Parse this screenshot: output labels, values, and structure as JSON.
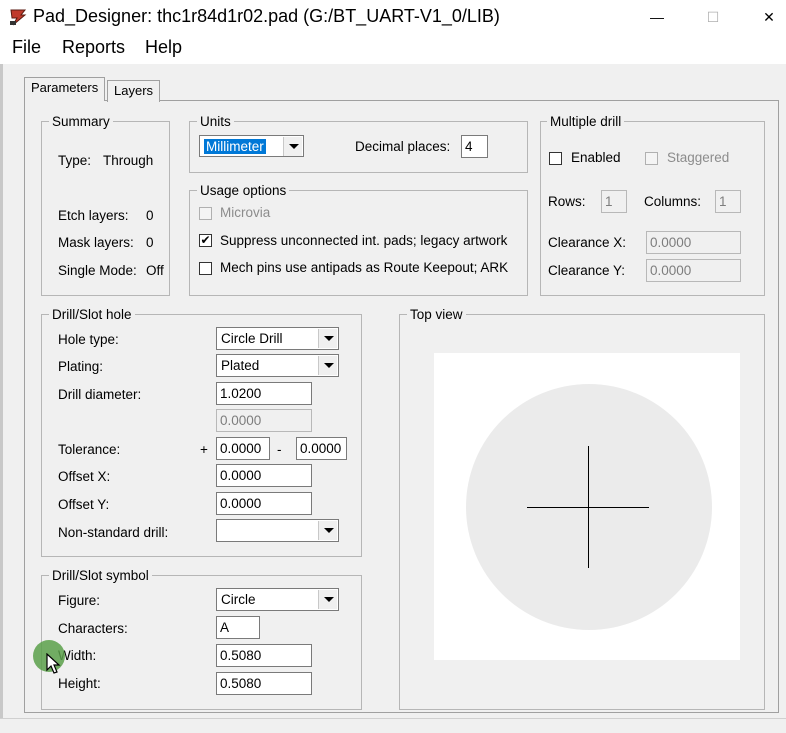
{
  "window": {
    "title": "Pad_Designer: thc1r84d1r02.pad (G:/BT_UART-V1_0/LIB)",
    "minimize_glyph": "—",
    "maximize_glyph": "☐",
    "close_glyph": "✕"
  },
  "menu": {
    "file": "File",
    "reports": "Reports",
    "help": "Help"
  },
  "tabs": {
    "parameters": "Parameters",
    "layers": "Layers"
  },
  "summary": {
    "title": "Summary",
    "type_label": "Type:",
    "type_value": "Through",
    "etch_label": "Etch layers:",
    "etch_value": "0",
    "mask_label": "Mask layers:",
    "mask_value": "0",
    "single_label": "Single Mode:",
    "single_value": "Off"
  },
  "units": {
    "title": "Units",
    "unit_value": "Millimeter",
    "decimal_label": "Decimal places:",
    "decimal_value": "4"
  },
  "usage": {
    "title": "Usage options",
    "microvia": {
      "label": "Microvia",
      "checked": false,
      "enabled": false
    },
    "suppress": {
      "label": "Suppress unconnected int. pads; legacy artwork",
      "checked": true,
      "mark": "✔"
    },
    "mech": {
      "label": "Mech pins use antipads as Route Keepout; ARK",
      "checked": false
    }
  },
  "multiple_drill": {
    "title": "Multiple drill",
    "enabled_label": "Enabled",
    "staggered_label": "Staggered",
    "rows_label": "Rows:",
    "rows_value": "1",
    "columns_label": "Columns:",
    "columns_value": "1",
    "clearance_x_label": "Clearance X:",
    "clearance_x_value": "0.0000",
    "clearance_y_label": "Clearance Y:",
    "clearance_y_value": "0.0000"
  },
  "drill_slot_hole": {
    "title": "Drill/Slot hole",
    "hole_type_label": "Hole type:",
    "hole_type_value": "Circle Drill",
    "plating_label": "Plating:",
    "plating_value": "Plated",
    "drill_diameter_label": "Drill diameter:",
    "drill_diameter_value": "1.0200",
    "secondary_value": "0.0000",
    "tolerance_label": "Tolerance:",
    "plus": "+",
    "minus": "-",
    "tolerance_plus_value": "0.0000",
    "tolerance_minus_value": "0.0000",
    "offset_x_label": "Offset X:",
    "offset_x_value": "0.0000",
    "offset_y_label": "Offset Y:",
    "offset_y_value": "0.0000",
    "non_standard_label": "Non-standard drill:",
    "non_standard_value": ""
  },
  "drill_slot_symbol": {
    "title": "Drill/Slot symbol",
    "figure_label": "Figure:",
    "figure_value": "Circle",
    "characters_label": "Characters:",
    "characters_value": "A",
    "width_label": "Width:",
    "width_value": "0.5080",
    "height_label": "Height:",
    "height_value": "0.5080"
  },
  "top_view": {
    "title": "Top view"
  },
  "colors": {
    "selection": "#0078d7",
    "pad_fill": "#ebebeb",
    "dialog_bg": "#f0f0f0",
    "app_icon": "#c0392b"
  },
  "icons": {
    "app": "pad-designer-icon",
    "cursor": "mouse-cursor-icon"
  }
}
